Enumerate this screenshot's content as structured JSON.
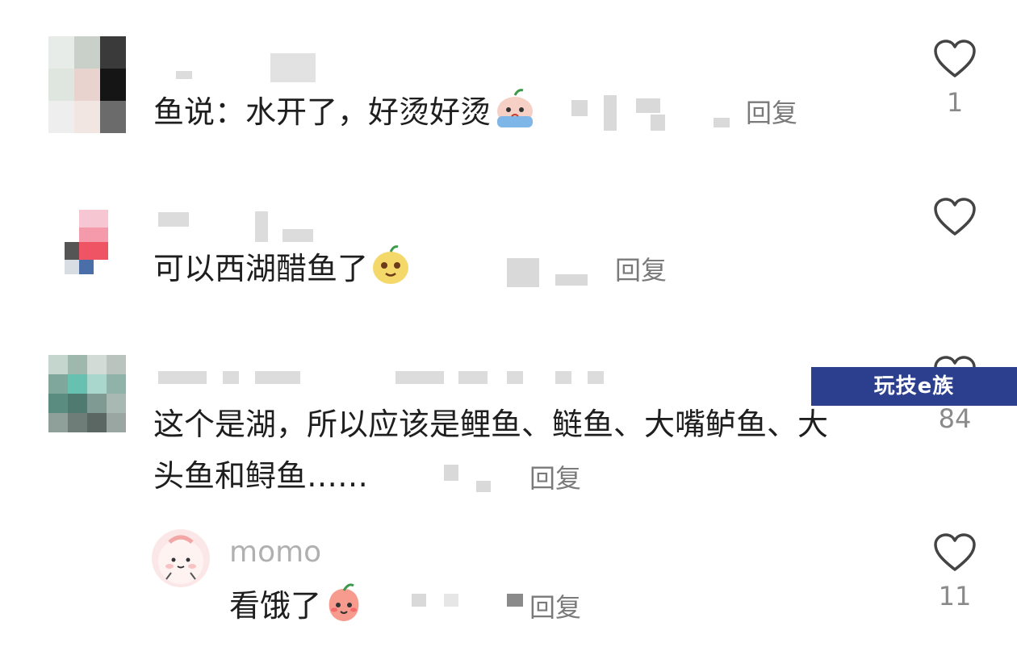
{
  "comments": [
    {
      "text": "鱼说：水开了，好烫好烫",
      "emoji": "crying-face-emoji",
      "reply_label": "回复",
      "likes": "1"
    },
    {
      "text": "可以西湖醋鱼了",
      "emoji": "smiling-face-emoji",
      "reply_label": "回复",
      "likes": ""
    },
    {
      "text_line1": "这个是湖，所以应该是鲤鱼、鲢鱼、大嘴鲈鱼、大",
      "text_line2": "头鱼和鲟鱼……",
      "reply_label": "回复",
      "likes": "84"
    }
  ],
  "reply_comment": {
    "username": "momo",
    "text": "看饿了",
    "emoji": "peach-face-emoji",
    "reply_label": "回复",
    "likes": "11"
  },
  "watermark": "玩技e族",
  "colors": {
    "text": "#1e1e1e",
    "muted": "#7a7a7a",
    "username": "#b0b0b0",
    "watermark_bg": "#2b3f8e"
  }
}
